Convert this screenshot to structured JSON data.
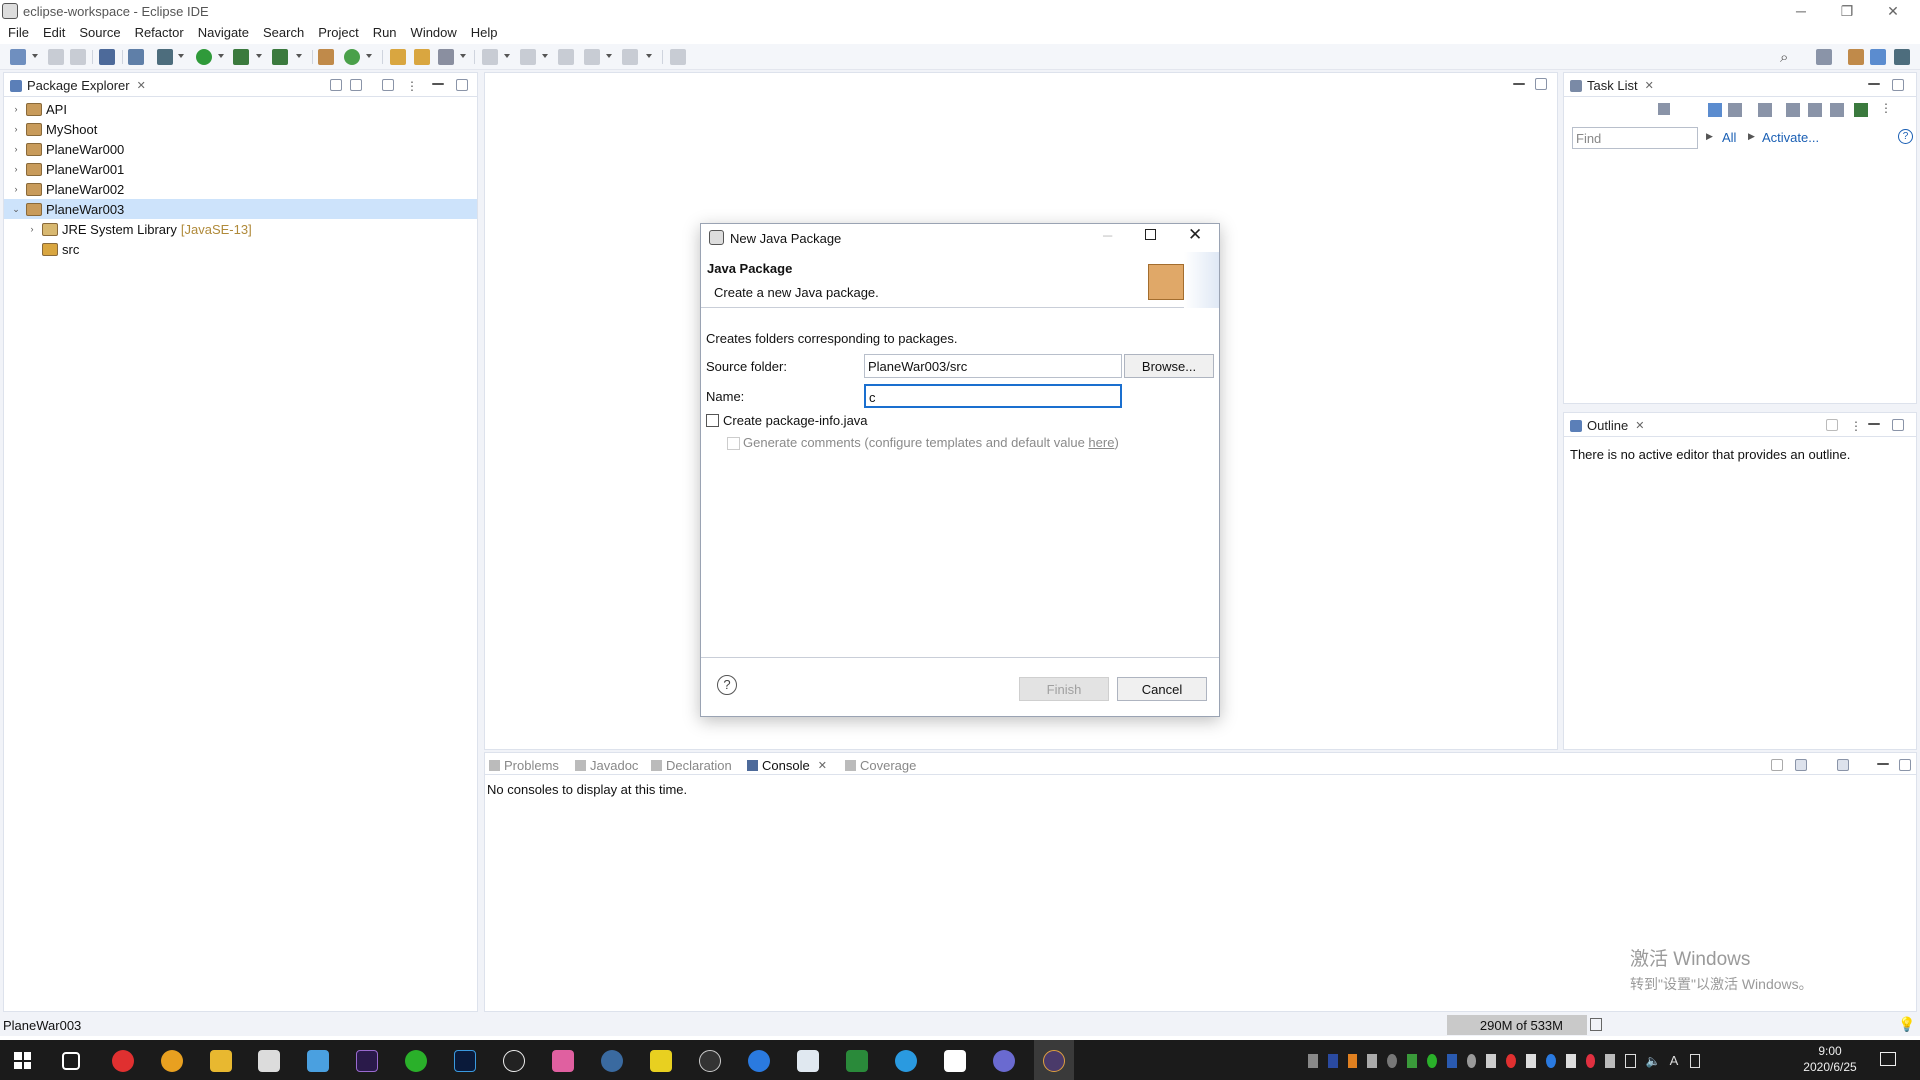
{
  "window": {
    "title": "eclipse-workspace - Eclipse IDE",
    "min_icon": "minimize-icon",
    "max_icon": "restore-icon",
    "close_icon": "close-icon"
  },
  "menu": [
    "File",
    "Edit",
    "Source",
    "Refactor",
    "Navigate",
    "Search",
    "Project",
    "Run",
    "Window",
    "Help"
  ],
  "package_explorer": {
    "tab_label": "Package Explorer",
    "items": [
      {
        "label": "API",
        "expanded": false
      },
      {
        "label": "MyShoot",
        "expanded": false
      },
      {
        "label": "PlaneWar000",
        "expanded": false
      },
      {
        "label": "PlaneWar001",
        "expanded": false
      },
      {
        "label": "PlaneWar002",
        "expanded": false
      },
      {
        "label": "PlaneWar003",
        "expanded": true,
        "selected": true
      },
      {
        "label": "JRE System Library",
        "decoration": "[JavaSE-13]",
        "indent": 1
      },
      {
        "label": "src",
        "indent": 1
      }
    ]
  },
  "task_list": {
    "tab_label": "Task List",
    "find_placeholder": "Find",
    "all_label": "All",
    "activate_label": "Activate..."
  },
  "outline": {
    "tab_label": "Outline",
    "message": "There is no active editor that provides an outline."
  },
  "bottom_tabs": [
    {
      "label": "Problems",
      "active": false
    },
    {
      "label": "Javadoc",
      "active": false
    },
    {
      "label": "Declaration",
      "active": false
    },
    {
      "label": "Console",
      "active": true
    },
    {
      "label": "Coverage",
      "active": false
    }
  ],
  "console": {
    "message": "No consoles to display at this time."
  },
  "status": {
    "selection": "PlaneWar003",
    "heap": "290M of 533M"
  },
  "watermark": {
    "line1": "激活 Windows",
    "line2": "转到\"设置\"以激活 Windows。"
  },
  "dialog": {
    "title": "New Java Package",
    "heading": "Java Package",
    "subheading": "Create a new Java package.",
    "intro": "Creates folders corresponding to packages.",
    "source_label": "Source folder:",
    "source_value": "PlaneWar003/src",
    "browse_label": "Browse...",
    "name_label": "Name:",
    "name_value": "c",
    "create_info_label": "Create package-info.java",
    "create_info_checked": false,
    "gen_comments_label": "Generate comments (configure templates and default value ",
    "here_link": "here",
    "gen_comments_suffix": ")",
    "finish_label": "Finish",
    "cancel_label": "Cancel"
  },
  "taskbar": {
    "time": "9:00",
    "date": "2020/6/25"
  }
}
